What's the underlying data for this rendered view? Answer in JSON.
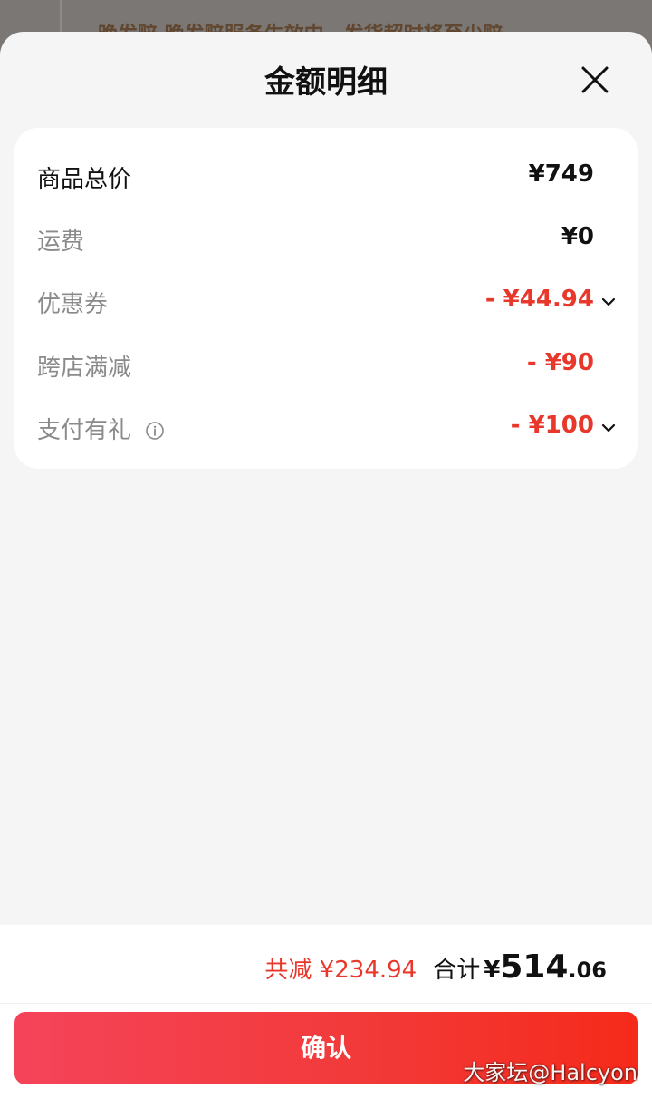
{
  "backdrop": {
    "strip_text": "晚发赔 晚发赔服务生效中，发货超时将至少赔"
  },
  "sheet": {
    "title": "金额明细"
  },
  "rows": [
    {
      "label": "商品总价",
      "value": "¥749"
    },
    {
      "label": "运费",
      "value": "¥0"
    },
    {
      "label": "优惠券",
      "value": "- ¥44.94"
    },
    {
      "label": "跨店满减",
      "value": "- ¥90"
    },
    {
      "label": "支付有礼",
      "value": "- ¥100"
    }
  ],
  "footer": {
    "saved": "共减 ¥234.94",
    "total_label": "合计",
    "total_yen": "¥",
    "total_int": "514",
    "total_dec": ".06",
    "confirm_label": "确认"
  },
  "watermark": "大家坛@Halcyon",
  "colors": {
    "accent_red": "#e8372b",
    "sheet_bg": "#f5f5f5"
  },
  "icons": {
    "close": "close-icon",
    "chevron": "chevron-down-icon",
    "info": "info-icon"
  }
}
